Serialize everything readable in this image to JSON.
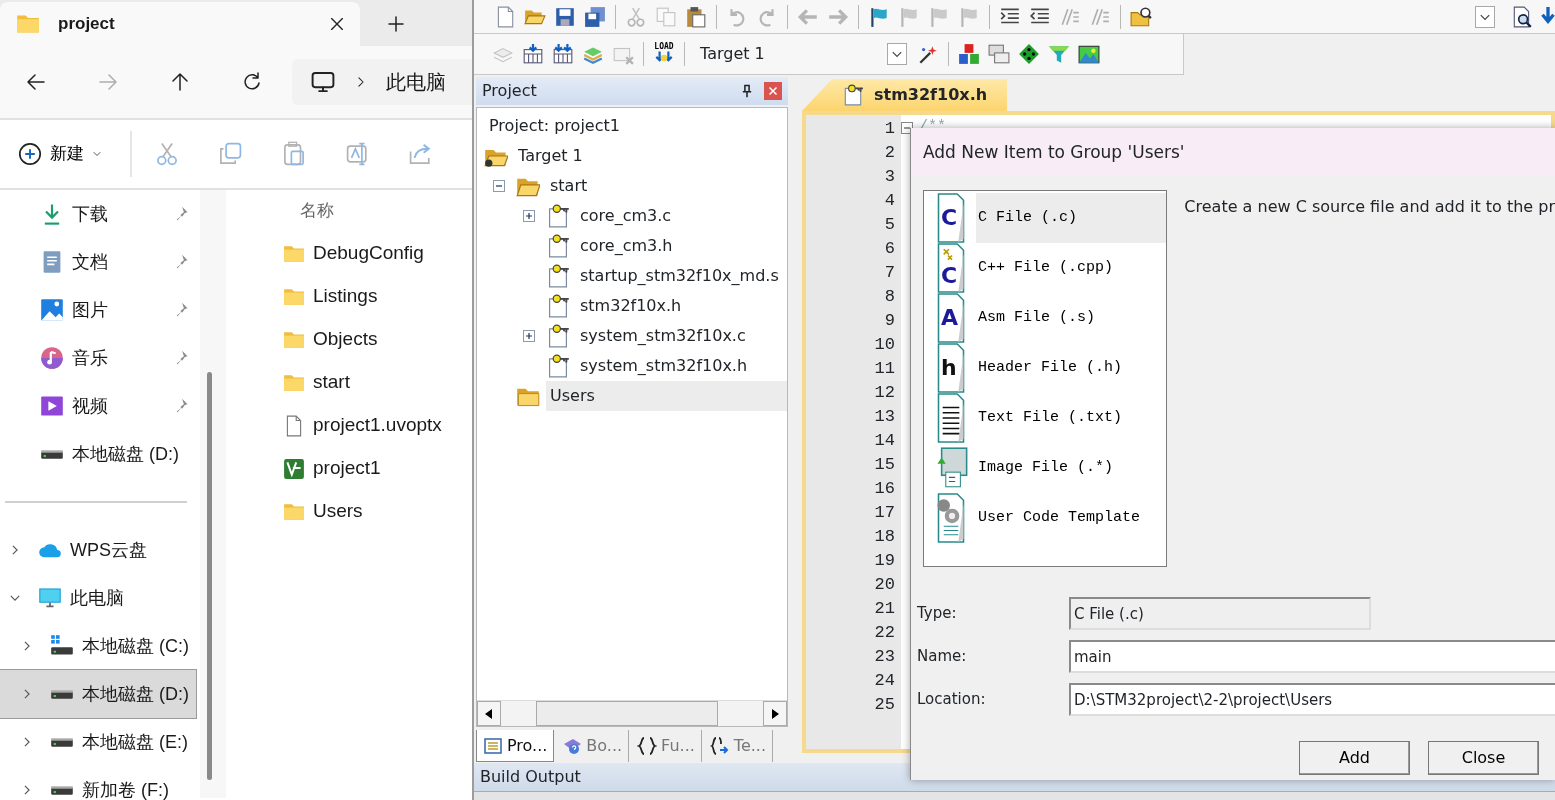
{
  "explorer": {
    "tab": {
      "title": "project"
    },
    "address": {
      "location": "此电脑"
    },
    "forward_disabled": true,
    "new_button": {
      "label": "新建"
    },
    "command_actions": [
      {
        "disabled": true
      },
      {
        "disabled": true
      },
      {
        "disabled": true
      },
      {
        "disabled": true
      },
      {
        "disabled": true
      }
    ],
    "quick_access": [
      {
        "label": "下载",
        "kind": "download",
        "pinned": true
      },
      {
        "label": "文档",
        "kind": "documents",
        "pinned": true
      },
      {
        "label": "图片",
        "kind": "pictures",
        "pinned": true
      },
      {
        "label": "音乐",
        "kind": "music",
        "pinned": true
      },
      {
        "label": "视频",
        "kind": "videos",
        "pinned": true
      },
      {
        "label": "本地磁盘 (D:)",
        "kind": "drive",
        "pinned": false
      }
    ],
    "tree": [
      {
        "label": "WPS云盘",
        "kind": "cloud",
        "expanded": false,
        "selected": false
      },
      {
        "label": "此电脑",
        "kind": "computer",
        "expanded": true,
        "selected": false,
        "children": [
          {
            "label": "本地磁盘 (C:)",
            "kind": "system_drive",
            "expanded": false,
            "selected": false
          },
          {
            "label": "本地磁盘 (D:)",
            "kind": "drive",
            "expanded": false,
            "selected": true
          },
          {
            "label": "本地磁盘 (E:)",
            "kind": "drive",
            "expanded": false,
            "selected": false
          },
          {
            "label": "新加卷 (F:)",
            "kind": "drive",
            "expanded": false,
            "selected": false
          }
        ]
      }
    ],
    "column_header": "名称",
    "files": [
      {
        "name": "DebugConfig",
        "kind": "folder"
      },
      {
        "name": "Listings",
        "kind": "folder"
      },
      {
        "name": "Objects",
        "kind": "folder"
      },
      {
        "name": "start",
        "kind": "folder"
      },
      {
        "name": "project1.uvoptx",
        "kind": "file"
      },
      {
        "name": "project1",
        "kind": "project"
      },
      {
        "name": "Users",
        "kind": "folder"
      }
    ]
  },
  "ide": {
    "toolbar_1": [
      [
        {
          "disabled": false
        },
        {
          "disabled": false
        },
        {
          "disabled": false
        },
        {
          "disabled": false
        }
      ],
      [
        {
          "disabled": true
        },
        {
          "disabled": true
        },
        {
          "disabled": false
        }
      ],
      [
        {
          "disabled": true
        },
        {
          "disabled": true
        }
      ],
      [
        {
          "disabled": true
        },
        {
          "disabled": true
        }
      ],
      [
        {
          "disabled": false
        },
        {
          "disabled": true
        },
        {
          "disabled": true
        },
        {
          "disabled": true
        }
      ],
      [
        {
          "disabled": false
        },
        {
          "disabled": false
        },
        {
          "disabled": true
        },
        {
          "disabled": true
        }
      ],
      [
        {
          "disabled": false
        }
      ]
    ],
    "toolbar_2": [
      [
        {
          "disabled": true
        },
        {
          "disabled": false
        },
        {
          "disabled": false
        },
        {
          "disabled": false
        },
        {
          "disabled": true
        }
      ],
      [
        {
          "disabled": false,
          "label": "LOAD"
        }
      ],
      [
        {
          "disabled": false
        },
        {
          "disabled": false
        }
      ],
      [
        {
          "disabled": false
        },
        {
          "disabled": false
        },
        {
          "disabled": false
        },
        {
          "disabled": false
        },
        {
          "disabled": false
        }
      ]
    ],
    "target_select": {
      "value": "Target 1"
    },
    "project_panel": {
      "title": "Project",
      "root": "Project: project1",
      "tree": [
        {
          "label": "Target 1",
          "kind": "target",
          "expanded": true,
          "selected": false,
          "children": [
            {
              "label": "start",
              "kind": "group",
              "expanded": true,
              "selected": false,
              "children": [
                {
                  "label": "core_cm3.c",
                  "kind": "file",
                  "expanded": false,
                  "selected": false
                },
                {
                  "label": "core_cm3.h",
                  "kind": "file",
                  "selected": false
                },
                {
                  "label": "startup_stm32f10x_md.s",
                  "kind": "file",
                  "selected": false
                },
                {
                  "label": "stm32f10x.h",
                  "kind": "file",
                  "selected": false
                },
                {
                  "label": "system_stm32f10x.c",
                  "kind": "file",
                  "expanded": false,
                  "selected": false
                },
                {
                  "label": "system_stm32f10x.h",
                  "kind": "file",
                  "selected": false
                }
              ]
            },
            {
              "label": "Users",
              "kind": "group",
              "selected": true
            }
          ]
        }
      ],
      "tabs": [
        {
          "label": "Pro...",
          "kind": "project",
          "selected": true
        },
        {
          "label": "Bo...",
          "kind": "books",
          "selected": false
        },
        {
          "label": "Fu...",
          "kind": "functions",
          "selected": false
        },
        {
          "label": "Te...",
          "kind": "templates",
          "selected": false
        }
      ]
    },
    "editor": {
      "tab": {
        "title": "stm32f10x.h"
      },
      "first_line": "/**",
      "line_numbers": [
        "1",
        "2",
        "3",
        "4",
        "5",
        "6",
        "7",
        "8",
        "9",
        "10",
        "11",
        "12",
        "13",
        "14",
        "15",
        "16",
        "17",
        "18",
        "19",
        "20",
        "21",
        "22",
        "23",
        "24",
        "25"
      ]
    },
    "build_output": {
      "title": "Build Output"
    }
  },
  "dialog": {
    "title": "Add New Item to Group 'Users'",
    "items": [
      {
        "label": "C File (.c)",
        "kind": "c",
        "glyph": "C",
        "selected": true
      },
      {
        "label": "C++ File (.cpp)",
        "kind": "cpp",
        "glyph": "C",
        "selected": false
      },
      {
        "label": "Asm File (.s)",
        "kind": "asm",
        "glyph": "A",
        "selected": false
      },
      {
        "label": "Header File (.h)",
        "kind": "header",
        "glyph": "h",
        "selected": false
      },
      {
        "label": "Text File (.txt)",
        "kind": "text",
        "selected": false
      },
      {
        "label": "Image File (.*)",
        "kind": "image",
        "selected": false
      },
      {
        "label": "User Code Template",
        "kind": "template",
        "selected": false
      }
    ],
    "description": "Create a new C source file and add it to the pr",
    "fields": [
      {
        "label": "Type:",
        "value": "C File (.c)",
        "disabled": true
      },
      {
        "label": "Name:",
        "value": "main",
        "disabled": false
      },
      {
        "label": "Location:",
        "value": "D:\\STM32project\\2-2\\project\\Users",
        "disabled": false
      }
    ],
    "buttons": [
      "Add",
      "Close"
    ]
  }
}
